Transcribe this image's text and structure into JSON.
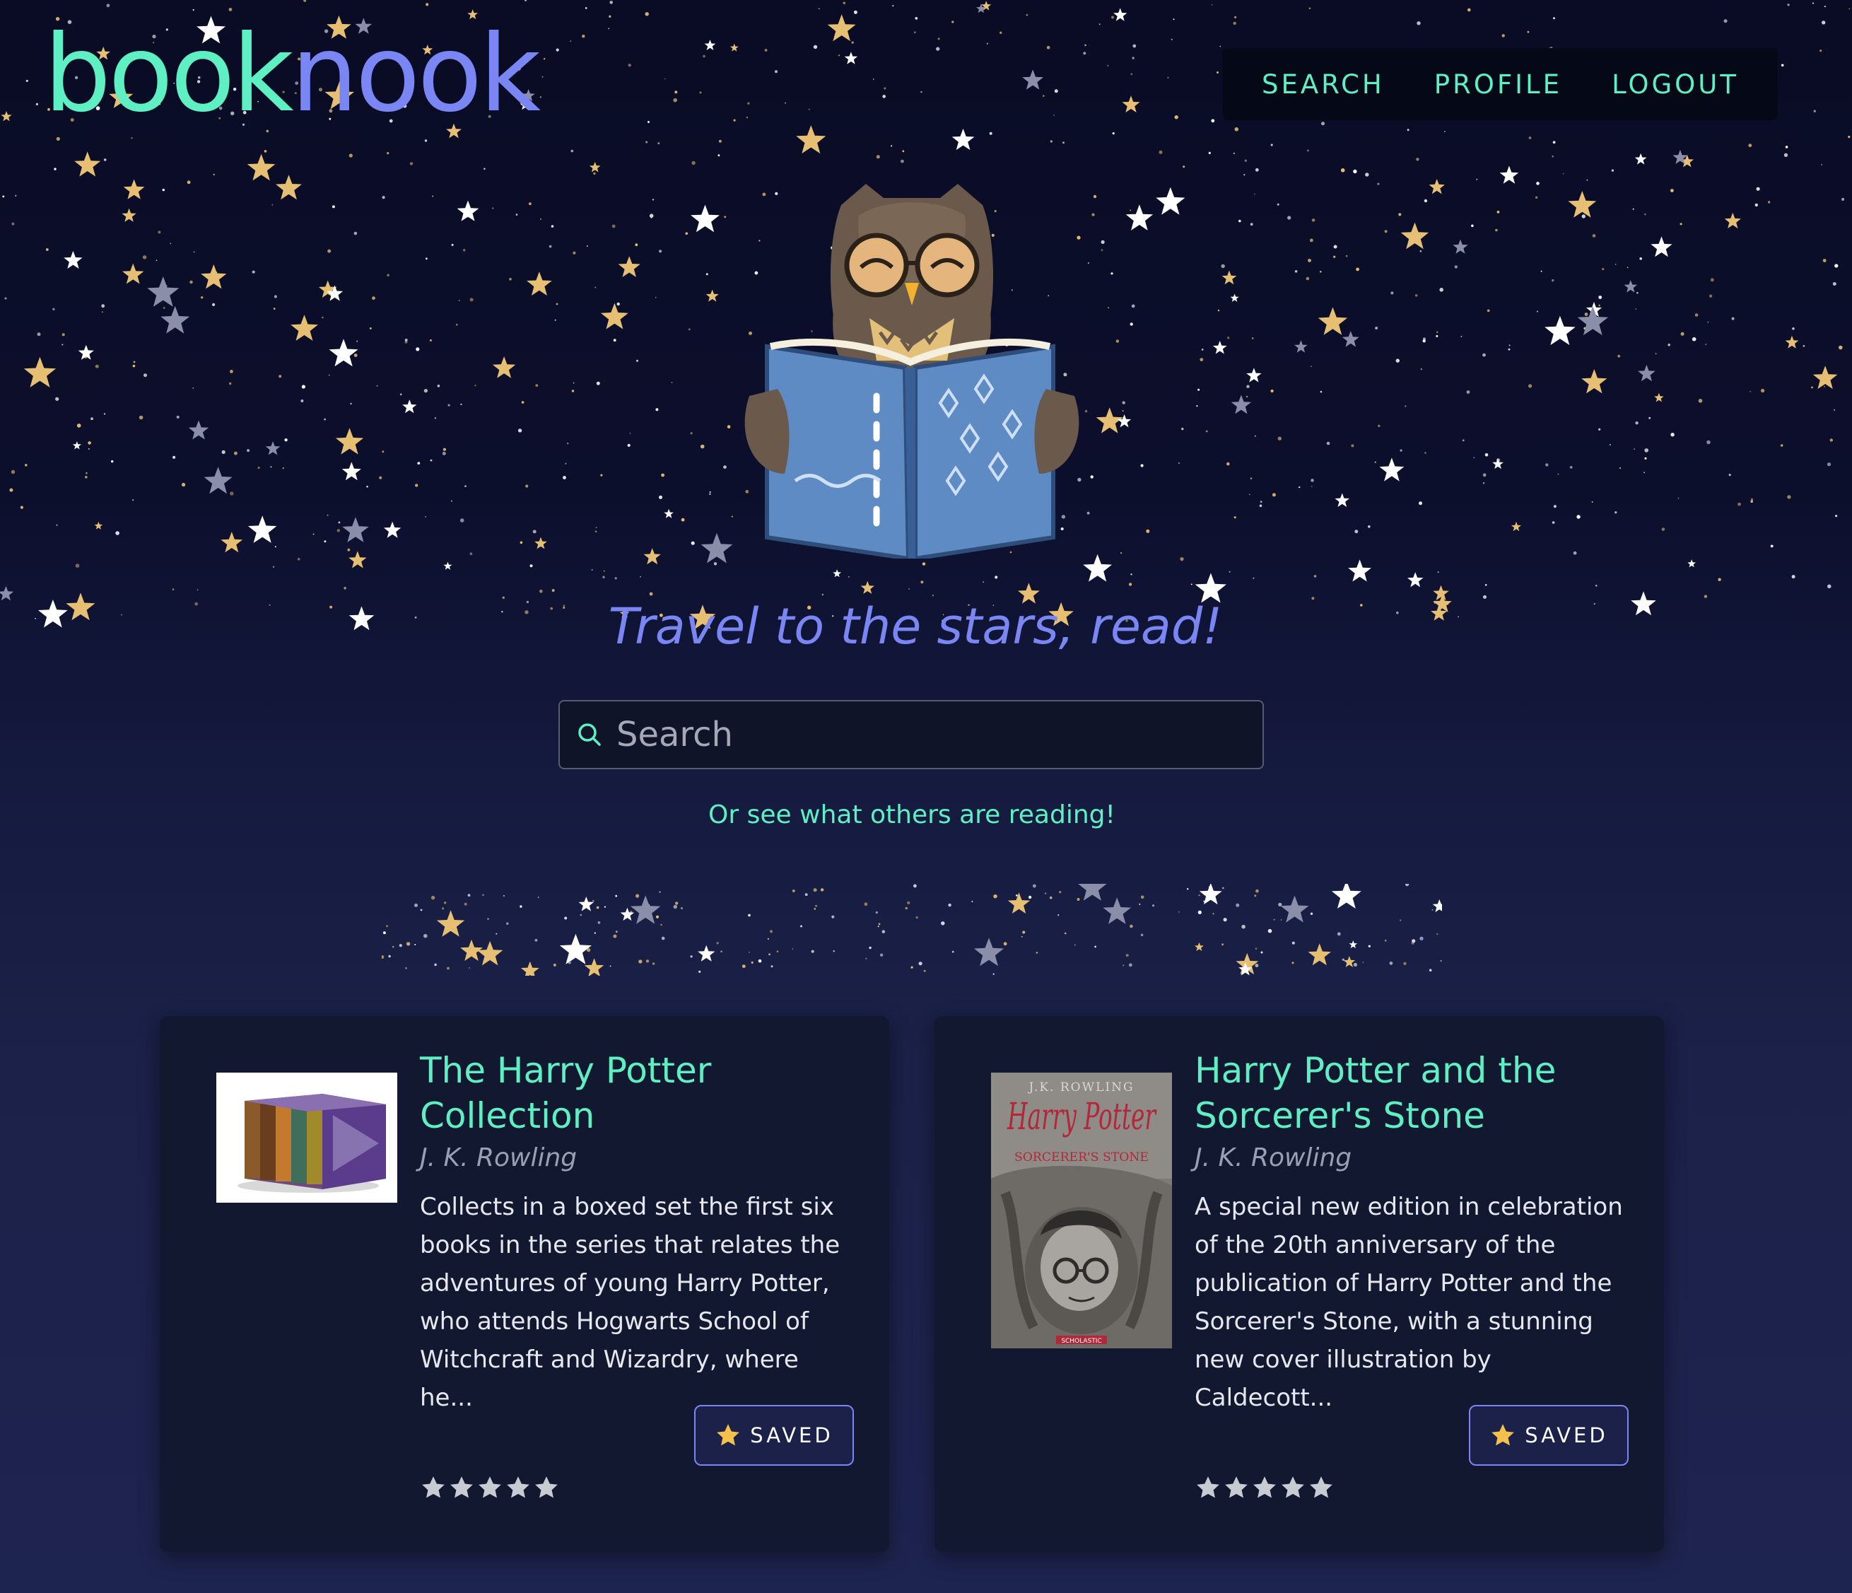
{
  "brand": {
    "part1": "book",
    "part2": "nook"
  },
  "nav": [
    {
      "label": "SEARCH"
    },
    {
      "label": "PROFILE"
    },
    {
      "label": "LOGOUT"
    }
  ],
  "hero": {
    "tagline": "Travel to the stars, read!"
  },
  "search": {
    "placeholder": "Search",
    "value": ""
  },
  "others_link": "Or see what others are reading!",
  "books": [
    {
      "title": "The Harry Potter Collection",
      "author": "J. K. Rowling",
      "description": "Collects in a boxed set the first six books in the series that relates the adventures of young Harry Potter, who attends Hogwarts School of Witchcraft and Wizardry, where he...",
      "saved_label": "SAVED",
      "rating": 0,
      "rating_max": 5
    },
    {
      "title": "Harry Potter and the Sorcerer's Stone",
      "author": "J. K. Rowling",
      "description": "A special new edition in celebration of the 20th anniversary of the publication of Harry Potter and the Sorcerer's Stone, with a stunning new cover illustration by Caldecott...",
      "saved_label": "SAVED",
      "rating": 0,
      "rating_max": 5
    }
  ],
  "cover_text": {
    "author": "J.K. ROWLING",
    "title": "Harry Potter",
    "subtitle": "SORCERER'S STONE",
    "publisher": "SCHOLASTIC"
  },
  "colors": {
    "accent_mint": "#5ef0c3",
    "accent_periwinkle": "#7b86f5",
    "card_bg": "#121830",
    "star_gold": "#e7bf72"
  },
  "icons": {
    "search": "search-icon",
    "saved": "star-icon",
    "rating": "star-icon"
  }
}
